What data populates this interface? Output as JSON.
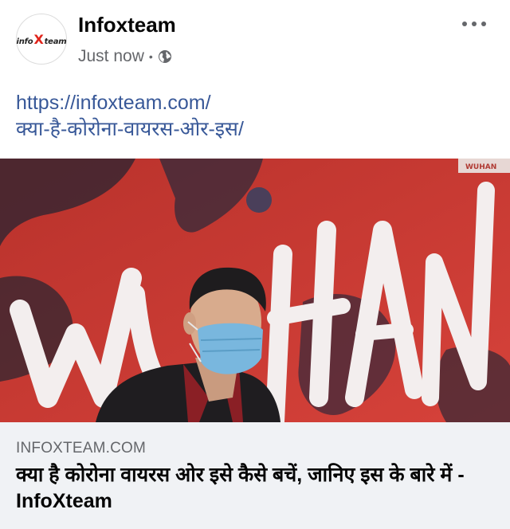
{
  "post": {
    "page_name": "Infoxteam",
    "timestamp": "Just now",
    "separator": "•",
    "privacy_icon": "globe-icon",
    "more_icon": "more-options-icon",
    "avatar": {
      "logo_left": "info",
      "logo_x": "X",
      "logo_right": "team"
    },
    "text_lines": [
      "https://infoxteam.com/",
      "क्या-है-कोरोना-वायरस-ओर-इस/"
    ]
  },
  "link_preview": {
    "image_icon": "photo-man-wearing-mask-icon",
    "banner_text": "WUHAN",
    "domain": "INFOXTEAM.COM",
    "title": "क्या है कोरोना वायरस ओर इसे कैसे बचें, जानिए इस के बारे में - InfoXteam"
  },
  "colors": {
    "link_text": "#385898",
    "secondary_text": "#65676b",
    "preview_background": "#f0f2f5",
    "banner_red": "#c7322d"
  }
}
